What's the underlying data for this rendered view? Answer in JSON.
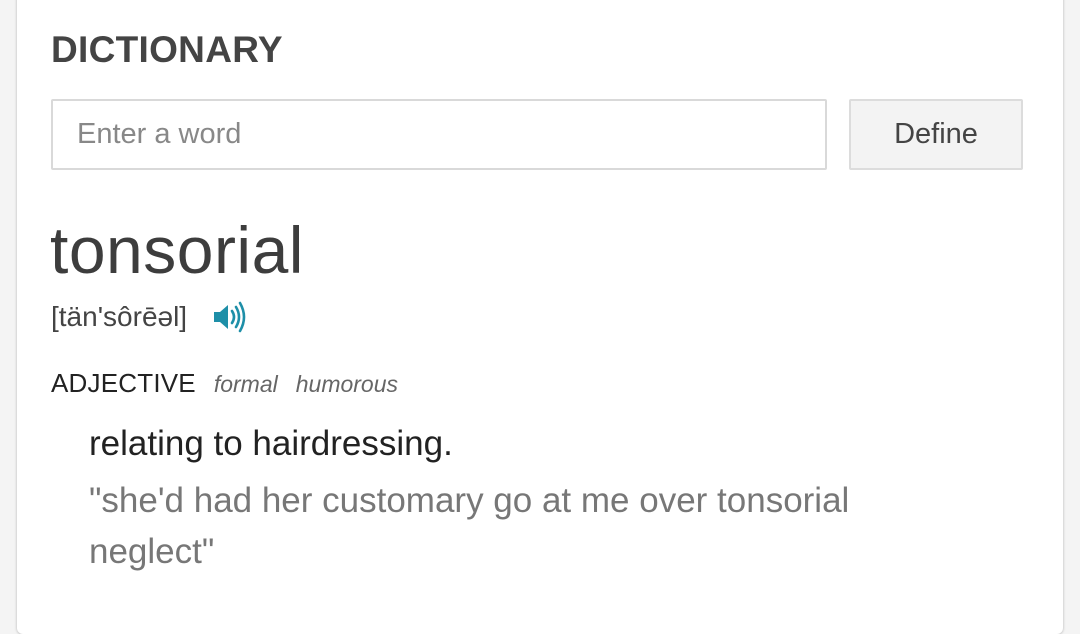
{
  "dictionary": {
    "title": "DICTIONARY",
    "search": {
      "placeholder": "Enter a word",
      "value": ""
    },
    "define_label": "Define",
    "entry": {
      "word": "tonsorial",
      "phonetic": "[tän'sôrēəl]",
      "audio_icon": "speaker-icon",
      "part_of_speech": "ADJECTIVE",
      "labels": [
        "formal",
        "humorous"
      ],
      "definition": "relating to hairdressing.",
      "example": "\"she'd had her customary go at me over tonsorial neglect\""
    },
    "colors": {
      "accent": "#1e8fa8",
      "text": "#444444",
      "muted": "#777777"
    }
  }
}
